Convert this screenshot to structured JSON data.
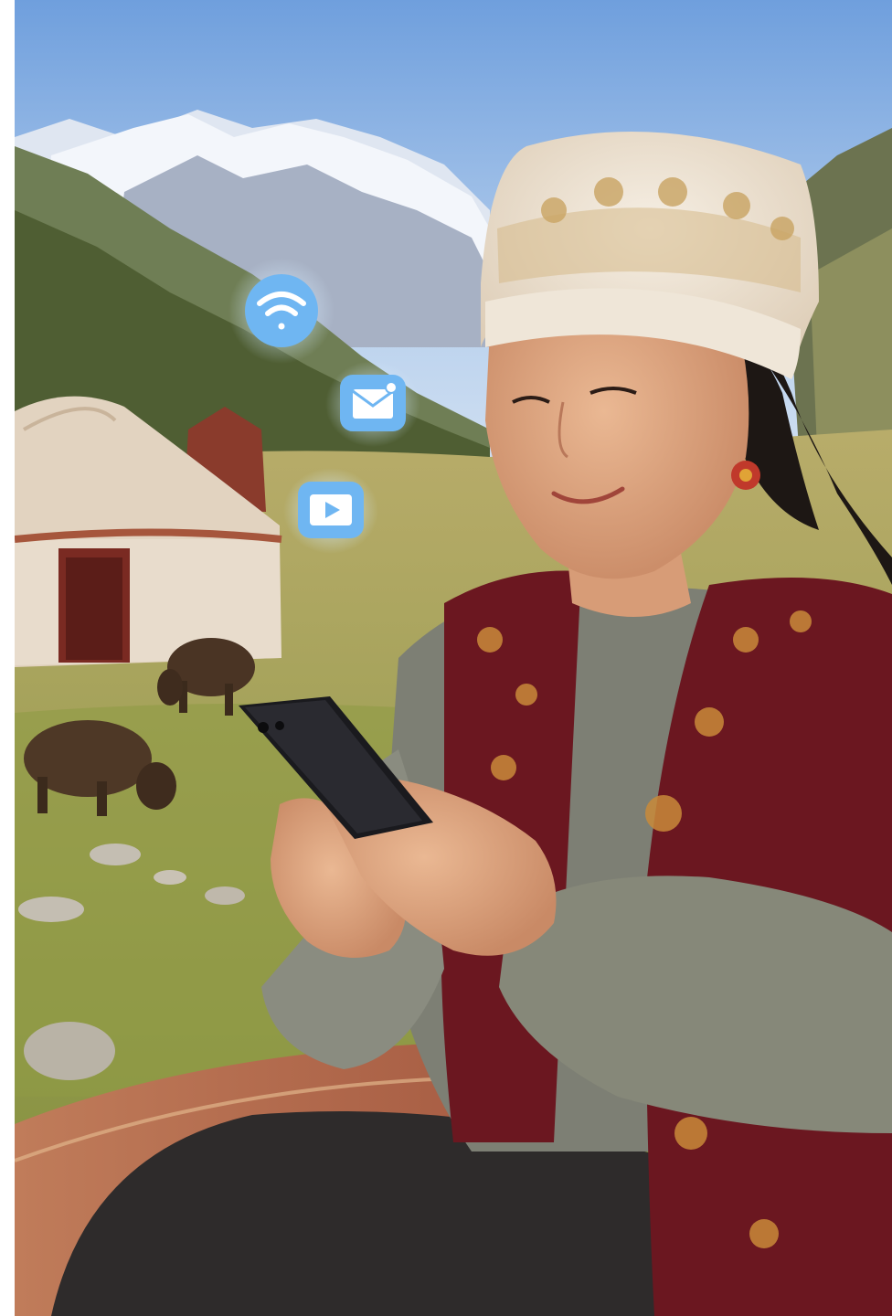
{
  "scene": {
    "description_free": true,
    "palette": {
      "sky_top": "#7fa9e0",
      "sky_bottom": "#cfe0f2",
      "snow": "#f2f5fa",
      "mountain_shadow": "#8c98ad",
      "forest": "#4f5e33",
      "meadow": "#a9a05a",
      "grass": "#8a9a42",
      "yurt": "#e2d3c0",
      "yurt_door": "#7a2a22",
      "yak": "#4a3424",
      "rug": "#b06a4a",
      "skirt": "#2e2b2b",
      "sweater": "#7d7f74",
      "vest": "#6b1720",
      "vest_embroidery": "#c98a3a",
      "skin": "#e0a883",
      "hair": "#1d1714",
      "hat": "#f1e8dc",
      "hat_gold": "#c9a463",
      "phone": "#1a1a1e",
      "badge_blue": "#6fb6f2",
      "badge_glow": "#bfe2ff"
    }
  },
  "badges": [
    {
      "name": "wifi-icon",
      "shape": "circle"
    },
    {
      "name": "mail-icon",
      "shape": "rounded-square"
    },
    {
      "name": "video-play-icon",
      "shape": "rounded-square"
    }
  ]
}
